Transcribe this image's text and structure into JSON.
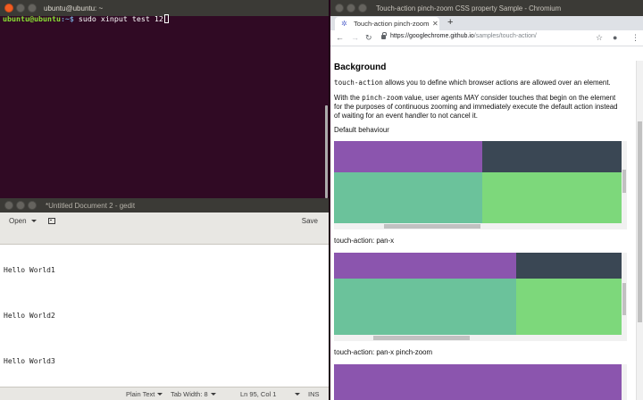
{
  "terminal": {
    "title": "ubuntu@ubuntu: ~",
    "prompt_user": "ubuntu@ubuntu",
    "prompt_path": ":~$",
    "command": " sudo xinput test 12"
  },
  "gedit": {
    "title": "*Untitled Document 2 - gedit",
    "open_label": "Open",
    "save_label": "Save",
    "lines": [
      "Hello World1",
      "Hello World2",
      "Hello World3"
    ],
    "status": {
      "language": "Plain Text",
      "tab_width": "Tab Width: 8",
      "position": "Ln 95, Col 1",
      "mode": "INS"
    }
  },
  "chrome": {
    "window_title": "Touch-action pinch-zoom CSS property Sample - Chromium",
    "tab_title": "Touch-action pinch-zoom",
    "url_host": "https://googlechrome.github.io",
    "url_path": "/samples/touch-action/",
    "page": {
      "heading": "Background",
      "p1_code": "touch-action",
      "p1_text": " allows you to define which browser actions are allowed over an element.",
      "p2_pre": "With the ",
      "p2_code": "pinch-zoom",
      "p2_text": " value, user agents MAY consider touches that begin on the element for the purposes of continuous zooming and immediately execute the default action instead of waiting for an event handler to not cancel it.",
      "demo1_label": "Default behaviour",
      "demo2_label": "touch-action: pan-x",
      "demo3_label": "touch-action: pan-x pinch-zoom"
    }
  },
  "colors": {
    "purple": "#8b55ae",
    "slate": "#3a4754",
    "teal": "#6bc29b",
    "green": "#7dd87b"
  }
}
